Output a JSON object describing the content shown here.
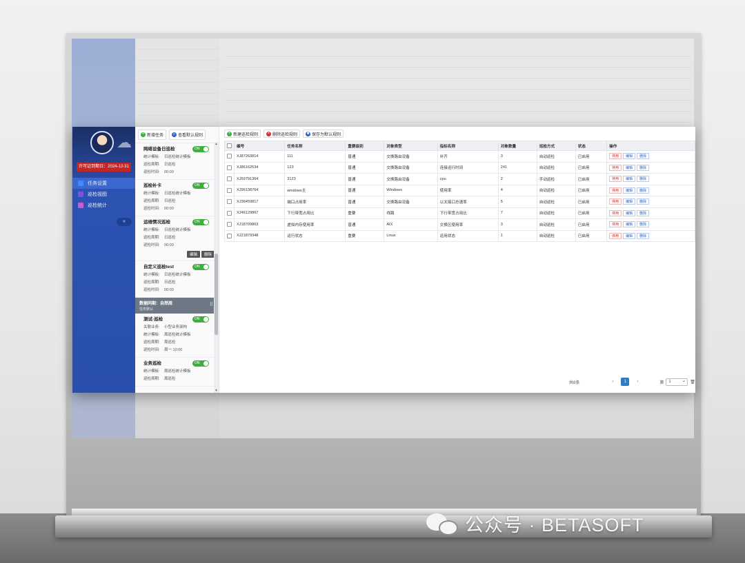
{
  "license": "许可证到期日：2024-12-31",
  "nav": [
    {
      "label": "任务设置",
      "color": "#3e8bff",
      "active": true
    },
    {
      "label": "巡检视图",
      "color": "#7b53e0",
      "active": false
    },
    {
      "label": "巡检统计",
      "color": "#c95bd6",
      "active": false
    }
  ],
  "collapse_glyph": "«",
  "panel_toolbar": {
    "add_task": "新增任务",
    "view_default_rules": "查看默认规则"
  },
  "tasks_before_group": [
    {
      "title": "网络设备日巡检",
      "toggle": "ON",
      "fields": [
        {
          "k": "统计模板:",
          "v": "日巡检统计模板"
        },
        {
          "k": "巡检周期:",
          "v": "日巡检"
        },
        {
          "k": "巡检时间:",
          "v": "00:00"
        }
      ]
    },
    {
      "title": "巡检补卡",
      "toggle": "ON",
      "fields": [
        {
          "k": "统计模板:",
          "v": "日巡检统计模板"
        },
        {
          "k": "巡检周期:",
          "v": "日巡检"
        },
        {
          "k": "巡检时间:",
          "v": "00:00"
        }
      ]
    },
    {
      "title": "运维情况巡检",
      "toggle": "ON",
      "actions": [
        "编辑",
        "删除"
      ],
      "fields": [
        {
          "k": "统计模板:",
          "v": "日巡检统计模板"
        },
        {
          "k": "巡检周期:",
          "v": "日巡检"
        },
        {
          "k": "巡检时间:",
          "v": "00:00"
        }
      ]
    },
    {
      "title": "自定义巡检test",
      "toggle": "ON",
      "fields": [
        {
          "k": "统计模板:",
          "v": "日巡检统计模板"
        },
        {
          "k": "巡检周期:",
          "v": "日巡检"
        },
        {
          "k": "巡检时间:",
          "v": "00:00"
        }
      ]
    }
  ],
  "group": {
    "title": "数据同期：自然周",
    "subtitle": "任务默认"
  },
  "tasks_after_group": [
    {
      "title": "测试-巡检",
      "toggle": "ON",
      "fields": [
        {
          "k": "关联业务:",
          "v": "小型业务架构"
        },
        {
          "k": "统计模板:",
          "v": "周巡检统计模板"
        },
        {
          "k": "巡检周期:",
          "v": "周巡检"
        },
        {
          "k": "巡检时间:",
          "v": "周一 10:00"
        }
      ]
    },
    {
      "title": "业务巡检",
      "toggle": "ON",
      "fields": [
        {
          "k": "统计模板:",
          "v": "周巡检统计模板"
        },
        {
          "k": "巡检周期:",
          "v": "周巡检"
        }
      ]
    }
  ],
  "main_toolbar": {
    "new_rule": "新建巡检规则",
    "delete_rule": "删除巡检规则",
    "save_default": "保存为默认规则"
  },
  "table": {
    "headers": [
      "编号",
      "任务名称",
      "重要级别",
      "对象类型",
      "指标名称",
      "对象数量",
      "巡检方式",
      "状态",
      "操作"
    ],
    "rows": [
      [
        "XJ87263814",
        "111",
        "普通",
        "交换路由设备",
        "补齐",
        "3",
        "自动巡检",
        "已启用"
      ],
      [
        "XJ86162534",
        "123",
        "普通",
        "交换路由设备",
        "连接运行时间",
        "241",
        "自动巡检",
        "已启用"
      ],
      [
        "XJ59791364",
        "3123",
        "普通",
        "交换路由设备",
        "cpu",
        "2",
        "手动巡检",
        "已启用"
      ],
      [
        "XJ96138764",
        "windows主",
        "普通",
        "Windows",
        "使用率",
        "4",
        "自动巡检",
        "已启用"
      ],
      [
        "XJ36459817",
        "端口占用率",
        "普通",
        "交换路由设备",
        "以太接口总速率",
        "5",
        "自动巡检",
        "已启用"
      ],
      [
        "XJ46129867",
        "下行带宽占用比",
        "重要",
        "线路",
        "下行带宽占用比",
        "7",
        "自动巡检",
        "已启用"
      ],
      [
        "XJ18709863",
        "虚拟内存使用率",
        "普通",
        "AIX",
        "交换区使用率",
        "3",
        "自动巡检",
        "已启用"
      ],
      [
        "XJ21879348",
        "运行状态",
        "重要",
        "Linux",
        "运用状态",
        "1",
        "自动巡检",
        "已启用"
      ]
    ],
    "actions": {
      "stop": "停用",
      "edit": "编辑",
      "delete": "删除"
    }
  },
  "pager": {
    "total": "共8条",
    "prev": "‹",
    "page": "1",
    "next": "›",
    "size_prefix": "第",
    "size_value": "1"
  },
  "watermark": {
    "text": "公众号 · BETASOFT"
  },
  "colors": {
    "accent": "#2c53b4",
    "success": "#3fae3f",
    "danger": "#d43030",
    "license": "#c32626"
  }
}
